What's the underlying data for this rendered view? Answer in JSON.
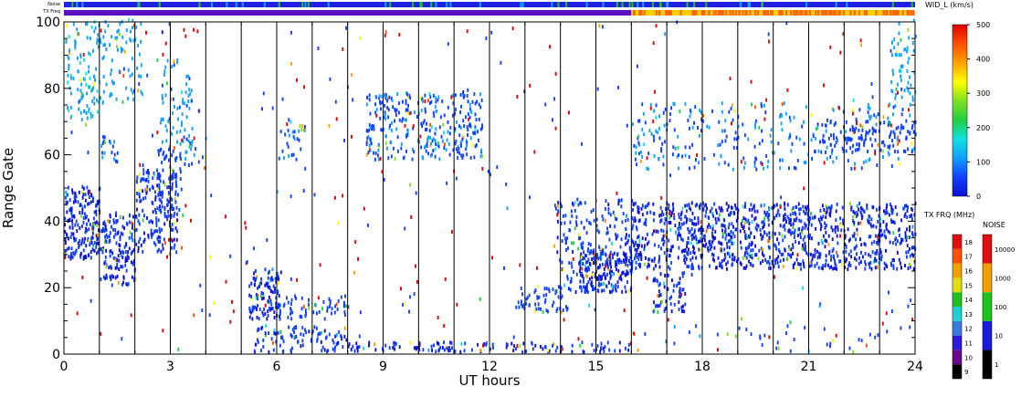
{
  "chart_data": {
    "type": "heatmap",
    "xlabel": "UT hours",
    "ylabel": "Range Gate",
    "xlim": [
      0,
      24
    ],
    "ylim": [
      0,
      100
    ],
    "x_ticks": [
      0,
      3,
      6,
      9,
      12,
      15,
      18,
      21,
      24
    ],
    "y_ticks": [
      0,
      20,
      40,
      60,
      80,
      100
    ],
    "grid": "vertical lines every hour",
    "status_bars": {
      "noise_label": "Noise",
      "txfreq_label": "TX Freq",
      "noise_level_color": "#2020e0",
      "txfreq_segments": [
        {
          "from": 0,
          "to": 16,
          "color": "#5a10c0"
        },
        {
          "from": 16,
          "to": 24,
          "color": "#ffd000"
        }
      ]
    },
    "colorbars": {
      "width": {
        "label": "WID_L (km/s)",
        "range": [
          0,
          500
        ],
        "ticks": [
          0,
          100,
          200,
          300,
          400,
          500
        ]
      },
      "txfreq": {
        "label": "TX FRQ (MHz)",
        "ticks": [
          9,
          10,
          11,
          12,
          13,
          14,
          15,
          16,
          17,
          18
        ],
        "colors": [
          "#000000",
          "#6a0a8a",
          "#2a1adf",
          "#3a7ae0",
          "#20d0d0",
          "#20c020",
          "#e0e010",
          "#f0a000",
          "#ff5000",
          "#e01010"
        ]
      },
      "noise": {
        "label": "NOISE",
        "ticks": [
          "1",
          "10",
          "100",
          "1000",
          "10000"
        ],
        "colors": [
          "#000000",
          "#1a1adf",
          "#20c020",
          "#f0a000",
          "#e01010"
        ]
      }
    },
    "colors": {
      "width_scale": [
        "#1010d0",
        "#1040ff",
        "#10a0ff",
        "#10e0e0",
        "#20d040",
        "#80e020",
        "#ffff00",
        "#ffa000",
        "#ff5000",
        "#e00000"
      ],
      "dominant": "#1a1ae0"
    },
    "regions": [
      {
        "x0": 0.0,
        "x1": 1.0,
        "y0": 28,
        "y1": 50,
        "density": 0.85,
        "level": 0.05
      },
      {
        "x0": 0.0,
        "x1": 1.0,
        "y0": 70,
        "y1": 100,
        "density": 0.35,
        "level": 0.22
      },
      {
        "x0": 1.0,
        "x1": 2.0,
        "y0": 20,
        "y1": 42,
        "density": 0.65,
        "level": 0.06
      },
      {
        "x0": 1.0,
        "x1": 2.2,
        "y0": 75,
        "y1": 100,
        "density": 0.25,
        "level": 0.2
      },
      {
        "x0": 1.0,
        "x1": 1.5,
        "y0": 55,
        "y1": 65,
        "density": 0.35,
        "level": 0.12
      },
      {
        "x0": 2.0,
        "x1": 3.2,
        "y0": 30,
        "y1": 55,
        "density": 0.55,
        "level": 0.07
      },
      {
        "x0": 2.6,
        "x1": 3.3,
        "y0": 40,
        "y1": 62,
        "density": 0.45,
        "level": 0.1
      },
      {
        "x0": 2.7,
        "x1": 3.6,
        "y0": 62,
        "y1": 88,
        "density": 0.28,
        "level": 0.18
      },
      {
        "x0": 3.3,
        "x1": 4.0,
        "y0": 55,
        "y1": 65,
        "density": 0.25,
        "level": 0.15
      },
      {
        "x0": 5.2,
        "x1": 6.1,
        "y0": 10,
        "y1": 25,
        "density": 0.8,
        "level": 0.06
      },
      {
        "x0": 6.0,
        "x1": 8.0,
        "y0": 10,
        "y1": 17,
        "density": 0.4,
        "level": 0.1
      },
      {
        "x0": 5.3,
        "x1": 8.0,
        "y0": 0,
        "y1": 8,
        "density": 0.45,
        "level": 0.08
      },
      {
        "x0": 6.0,
        "x1": 6.8,
        "y0": 58,
        "y1": 70,
        "density": 0.3,
        "level": 0.14
      },
      {
        "x0": 8.5,
        "x1": 11.8,
        "y0": 58,
        "y1": 78,
        "density": 0.45,
        "level": 0.13
      },
      {
        "x0": 8.0,
        "x1": 16.0,
        "y0": 0,
        "y1": 3,
        "density": 0.5,
        "level": 0.06
      },
      {
        "x0": 12.7,
        "x1": 14.2,
        "y0": 12,
        "y1": 20,
        "density": 0.45,
        "level": 0.1
      },
      {
        "x0": 13.8,
        "x1": 16.0,
        "y0": 18,
        "y1": 46,
        "density": 0.35,
        "level": 0.08
      },
      {
        "x0": 14.5,
        "x1": 16.0,
        "y0": 18,
        "y1": 30,
        "density": 0.85,
        "level": 0.05
      },
      {
        "x0": 16.0,
        "x1": 24.0,
        "y0": 25,
        "y1": 45,
        "density": 0.65,
        "level": 0.05
      },
      {
        "x0": 16.6,
        "x1": 17.5,
        "y0": 12,
        "y1": 24,
        "density": 0.6,
        "level": 0.06
      },
      {
        "x0": 16.0,
        "x1": 24.0,
        "y0": 55,
        "y1": 75,
        "density": 0.18,
        "level": 0.15
      },
      {
        "x0": 21.0,
        "x1": 24.0,
        "y0": 60,
        "y1": 70,
        "density": 0.35,
        "level": 0.1
      },
      {
        "x0": 23.3,
        "x1": 24.0,
        "y0": 75,
        "y1": 100,
        "density": 0.3,
        "level": 0.2
      },
      {
        "x0": 16.0,
        "x1": 24.0,
        "y0": 0,
        "y1": 8,
        "density": 0.06,
        "level": 0.12
      }
    ],
    "scatter_noise_density": 0.012
  }
}
